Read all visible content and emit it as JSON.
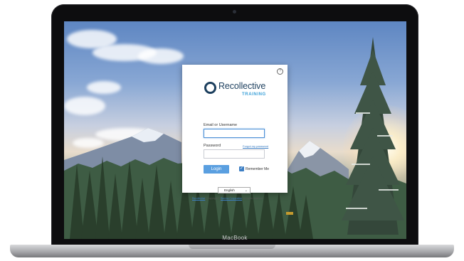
{
  "device": {
    "brand_label": "MacBook"
  },
  "login_card": {
    "logo_text": "Recollective",
    "logo_subtext": "TRAINING",
    "email_label": "Email or Username",
    "email_value": "",
    "password_label": "Password",
    "password_value": "",
    "forgot_link": "Forgot my password",
    "login_button": "Login",
    "remember_me_label": "Remember Me",
    "remember_me_checked": true,
    "language_selected": "English",
    "footer": {
      "link1": "Recollective",
      "sep": " | Copyright © ",
      "link2": "Ramius Corporation",
      "rights": ". All rights reserved."
    },
    "help_icon": "question-circle-icon"
  },
  "colors": {
    "accent": "#5a9fe0",
    "logo_navy": "#1c3f5e",
    "logo_blue": "#3aa0d8"
  }
}
